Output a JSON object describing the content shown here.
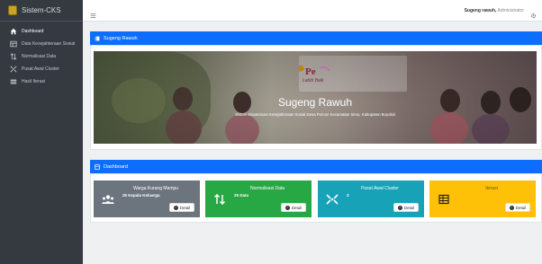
{
  "sidebar": {
    "brand": "Sistem-CKS",
    "items": [
      {
        "label": "Dashboard",
        "icon": "home-icon",
        "active": true
      },
      {
        "label": "Data Kesejahteraan Sosial",
        "icon": "table-icon",
        "active": false
      },
      {
        "label": "Normalisasi Data",
        "icon": "sort-arrows-icon",
        "active": false
      },
      {
        "label": "Pusat Awal Cluster",
        "icon": "cluster-icon",
        "active": false
      },
      {
        "label": "Hasil Iterasi",
        "icon": "list-icon",
        "active": false
      }
    ]
  },
  "topbar": {
    "user_name": "Sugeng rawuh,",
    "user_role": " Administrator"
  },
  "welcome_section": {
    "title": "Sugeng Rawuh",
    "hero_title": "Sugeng Rawuh",
    "hero_subtitle": "Sistem Klasterisasi Kesejahteraan Sosial Desa Pemon Kecamatan Simo, Kabupaten Boyolali",
    "logo_tagline": "Lebih Baik"
  },
  "dashboard_section": {
    "title": "Dashboard",
    "cards": [
      {
        "title": "Warga Kurang Mampu",
        "value": "25 Kepala Keluarga",
        "button": "Detail",
        "color": "#6c757d",
        "icon": "users-icon"
      },
      {
        "title": "Normalisasi Data",
        "value": "25 Data",
        "button": "Detail",
        "color": "#28a745",
        "icon": "sort-arrows-icon"
      },
      {
        "title": "Pusat Awal Cluster",
        "value": "3",
        "button": "Detail",
        "color": "#17a2b8",
        "icon": "cluster-icon"
      },
      {
        "title": "Iterasi",
        "value": "",
        "button": "Detail",
        "color": "#ffc107",
        "icon": "list-icon"
      }
    ]
  }
}
